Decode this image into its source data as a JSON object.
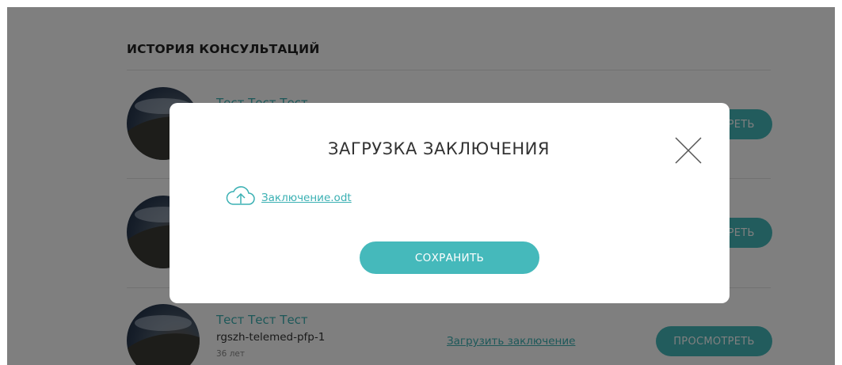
{
  "history": {
    "title": "ИСТОРИЯ КОНСУЛЬТАЦИЙ",
    "consultations": [
      {
        "name": "Тест Тест Тест",
        "view_label": "ПРОСМОТРЕТЬ"
      },
      {
        "view_label": "ПРОСМОТРЕТЬ"
      },
      {
        "name": "Тест Тест Тест",
        "login": "rgszh-telemed-pfp-1",
        "age": "36 лет",
        "upload_label": "Загрузить заключение",
        "view_label": "ПРОСМОТРЕТЬ"
      }
    ]
  },
  "modal": {
    "title": "ЗАГРУЗКА ЗАКЛЮЧЕНИЯ",
    "file_name": "Заключение.odt",
    "save_label": "СОХРАНИТЬ",
    "close_icon": "close-icon",
    "upload_icon": "cloud-upload-icon"
  },
  "colors": {
    "accent": "#45b9bb",
    "link": "#3ab0b3",
    "overlay": "rgba(0,0,0,0.50)"
  }
}
